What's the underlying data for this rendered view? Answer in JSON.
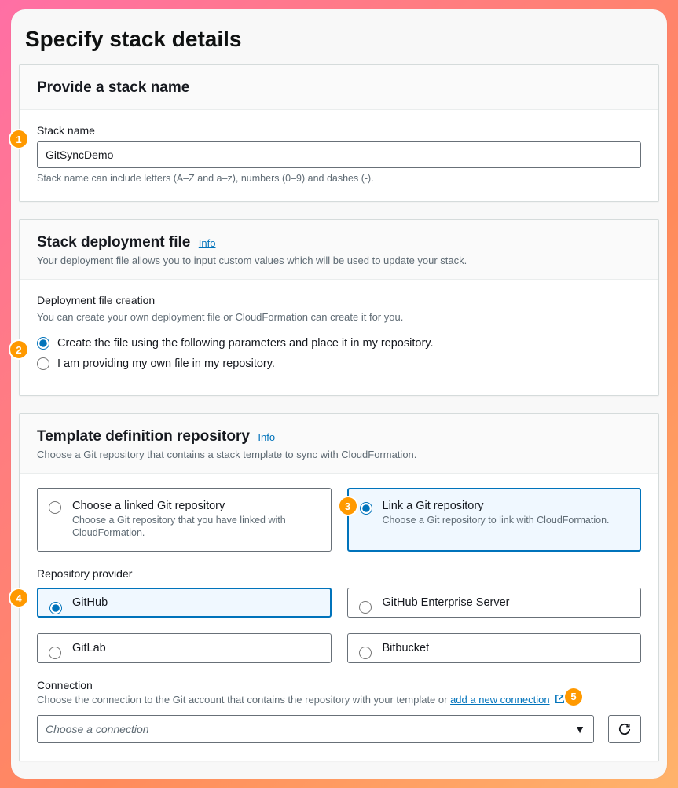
{
  "pageTitle": "Specify stack details",
  "stackName": {
    "cardTitle": "Provide a stack name",
    "label": "Stack name",
    "value": "GitSyncDemo",
    "hint": "Stack name can include letters (A–Z and a–z), numbers (0–9) and dashes (-)."
  },
  "deployment": {
    "cardTitle": "Stack deployment file",
    "info": "Info",
    "cardDesc": "Your deployment file allows you to input custom values which will be used to update your stack.",
    "label": "Deployment file creation",
    "sub": "You can create your own deployment file or CloudFormation can create it for you.",
    "option1": "Create the file using the following parameters and place it in my repository.",
    "option2": "I am providing my own file in my repository."
  },
  "repo": {
    "cardTitle": "Template definition repository",
    "info": "Info",
    "cardDesc": "Choose a Git repository that contains a stack template to sync with CloudFormation.",
    "linkedTitle": "Choose a linked Git repository",
    "linkedDesc": "Choose a Git repository that you have linked with CloudFormation.",
    "newTitle": "Link a Git repository",
    "newDesc": "Choose a Git repository to link with CloudFormation.",
    "providerLabel": "Repository provider",
    "providers": {
      "github": "GitHub",
      "ghes": "GitHub Enterprise Server",
      "gitlab": "GitLab",
      "bitbucket": "Bitbucket"
    },
    "connection": {
      "label": "Connection",
      "desc": "Choose the connection to the Git account that contains the repository with your template or ",
      "link": "add a new connection",
      "placeholder": "Choose a connection"
    }
  },
  "badges": {
    "b1": "1",
    "b2": "2",
    "b3": "3",
    "b4": "4",
    "b5": "5"
  }
}
